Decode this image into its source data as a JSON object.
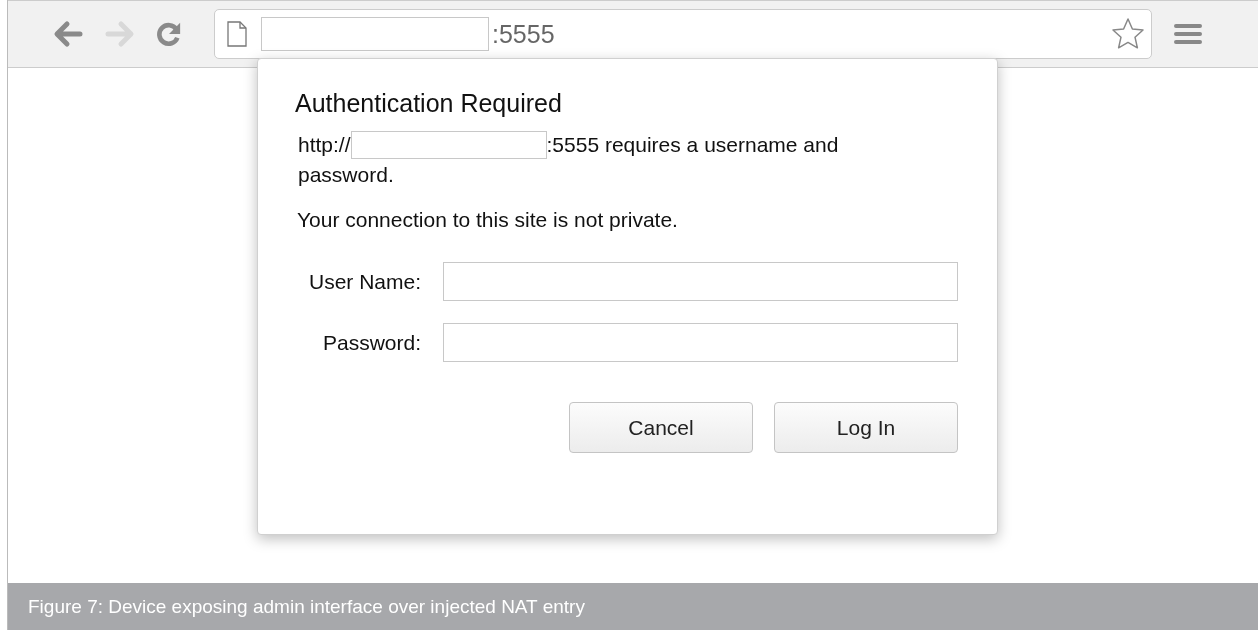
{
  "browser": {
    "address_suffix": ":5555"
  },
  "dialog": {
    "title": "Authentication Required",
    "message_prefix": "http://",
    "message_suffix": ":5555 requires a username and",
    "message_continuation": "password.",
    "warning": "Your connection to this site is not private.",
    "fields": [
      {
        "label": "User Name:"
      },
      {
        "label": "Password:"
      }
    ],
    "buttons": [
      "Cancel",
      "Log In"
    ]
  },
  "caption": "Figure 7: Device exposing admin interface over injected NAT entry"
}
